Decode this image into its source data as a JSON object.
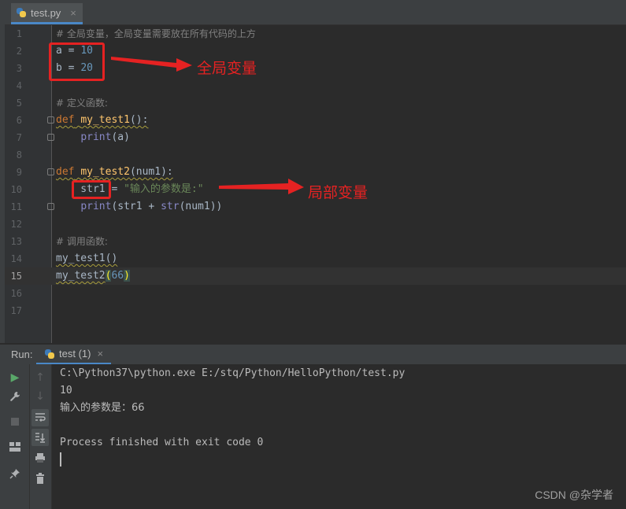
{
  "editor_tab": {
    "label": "test.py",
    "close_glyph": "×",
    "icon": "python-file-icon"
  },
  "editor": {
    "current_line": 15,
    "line_numbers": [
      "1",
      "2",
      "3",
      "4",
      "5",
      "6",
      "7",
      "8",
      "9",
      "10",
      "11",
      "12",
      "13",
      "14",
      "15",
      "16",
      "17"
    ]
  },
  "annotations": {
    "global_label": "全局变量",
    "local_label": "局部变量",
    "color": "#e52222"
  },
  "run_panel": {
    "title": "Run:",
    "tab_label": "test (1)",
    "tab_close": "×",
    "toolbar_icons": [
      "run-icon",
      "up-arrow-icon",
      "wrench-icon",
      "down-arrow-icon",
      "stop-icon",
      "soft-wrap-icon",
      "layout-icon",
      "scroll-to-end-icon",
      "print-icon",
      "pin-icon",
      "trash-icon"
    ],
    "console": [
      "C:\\Python37\\python.exe E:/stq/Python/HelloPython/test.py",
      "10",
      "输入的参数是：66",
      "",
      "Process finished with exit code 0"
    ]
  },
  "watermark": "CSDN @杂学者",
  "colors": {
    "background": "#2b2b2b",
    "keyword": "#cc7832",
    "function": "#ffc66d",
    "number": "#6897bb",
    "string": "#6a8759",
    "comment": "#808080",
    "accent": "#4a88c7"
  }
}
